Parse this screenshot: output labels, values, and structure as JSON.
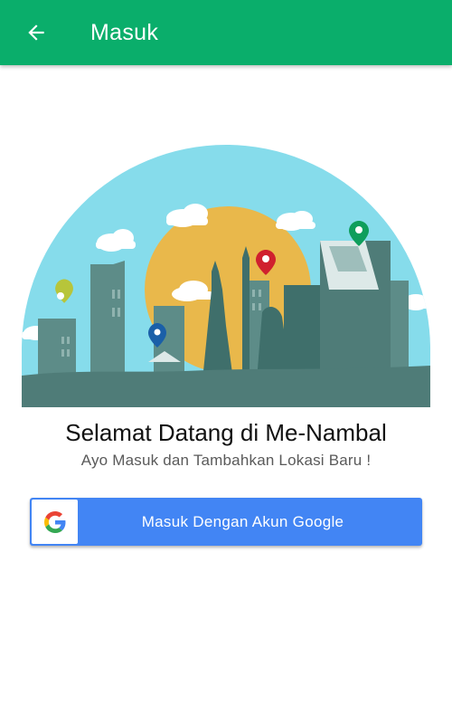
{
  "app_bar": {
    "title": "Masuk",
    "back_icon": "arrow-back-icon",
    "color": "#0AAE6B"
  },
  "illustration": {
    "subject": "city-skyline-with-location-pins",
    "sky_color": "#86DCEB",
    "sun_color": "#E9B84B",
    "building_color": "#4F7C78",
    "pin_colors": [
      "#B7C53A",
      "#1A5FA8",
      "#D0202E",
      "#0E9E5C"
    ]
  },
  "welcome": {
    "title": "Selamat Datang di Me-Nambal",
    "subtitle": "Ayo Masuk dan Tambahkan Lokasi Baru !"
  },
  "google_button": {
    "label": "Masuk Dengan Akun Google",
    "icon": "google-icon",
    "color": "#4285F4"
  }
}
